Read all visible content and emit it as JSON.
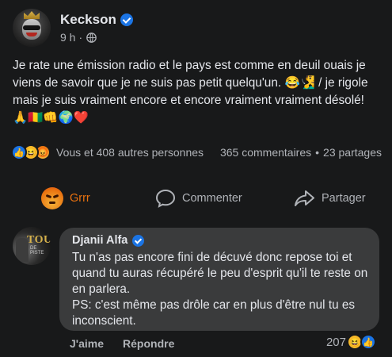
{
  "post": {
    "author": "Keckson",
    "time": "9 h",
    "dot": "·",
    "text": "Je rate une émission radio et le pays est comme en deuil ouais je viens de savoir que je ne suis pas petit quelqu'un. 😂🧏‍♂️ / je rigole mais je suis vraiment encore et encore vraiment vraiment désolé! 🙏🇬🇳👊🌍❤️"
  },
  "stats": {
    "likes_text": "Vous et 408 autres personnes",
    "comments": "365 commentaires",
    "separator": "•",
    "shares": "23 partages"
  },
  "reaction_icons": {
    "like": "👍",
    "haha": "😆",
    "angry": "😡"
  },
  "actions": {
    "grr": "Grrr",
    "comment": "Commenter",
    "share": "Partager"
  },
  "comment": {
    "author": "Djanii Alfa",
    "avatar_text": "TOUR",
    "avatar_subtext": "DE PISTE",
    "text": "Tu n'as pas encore fini de décuvé donc repose toi et quand tu auras récupéré le peu d'esprit qu'il te reste on en parlera.\nPS: c'est même pas drôle car en plus d'être nul tu es inconscient.",
    "like_label": "J'aime",
    "reply_label": "Répondre",
    "reaction_count": "207",
    "reaction_icons": {
      "haha": "😆",
      "like": "👍"
    }
  },
  "colors": {
    "background": "#18191a",
    "bubble": "#3a3b3c",
    "text_primary": "#e4e6eb",
    "text_secondary": "#b0b3b8",
    "brand_blue": "#1b74e4",
    "grr_orange": "#e9710f"
  },
  "icons": [
    "verified-badge-icon",
    "globe-icon",
    "like-icon",
    "haha-icon",
    "angry-icon",
    "comment-bubble-icon",
    "share-arrow-icon"
  ]
}
